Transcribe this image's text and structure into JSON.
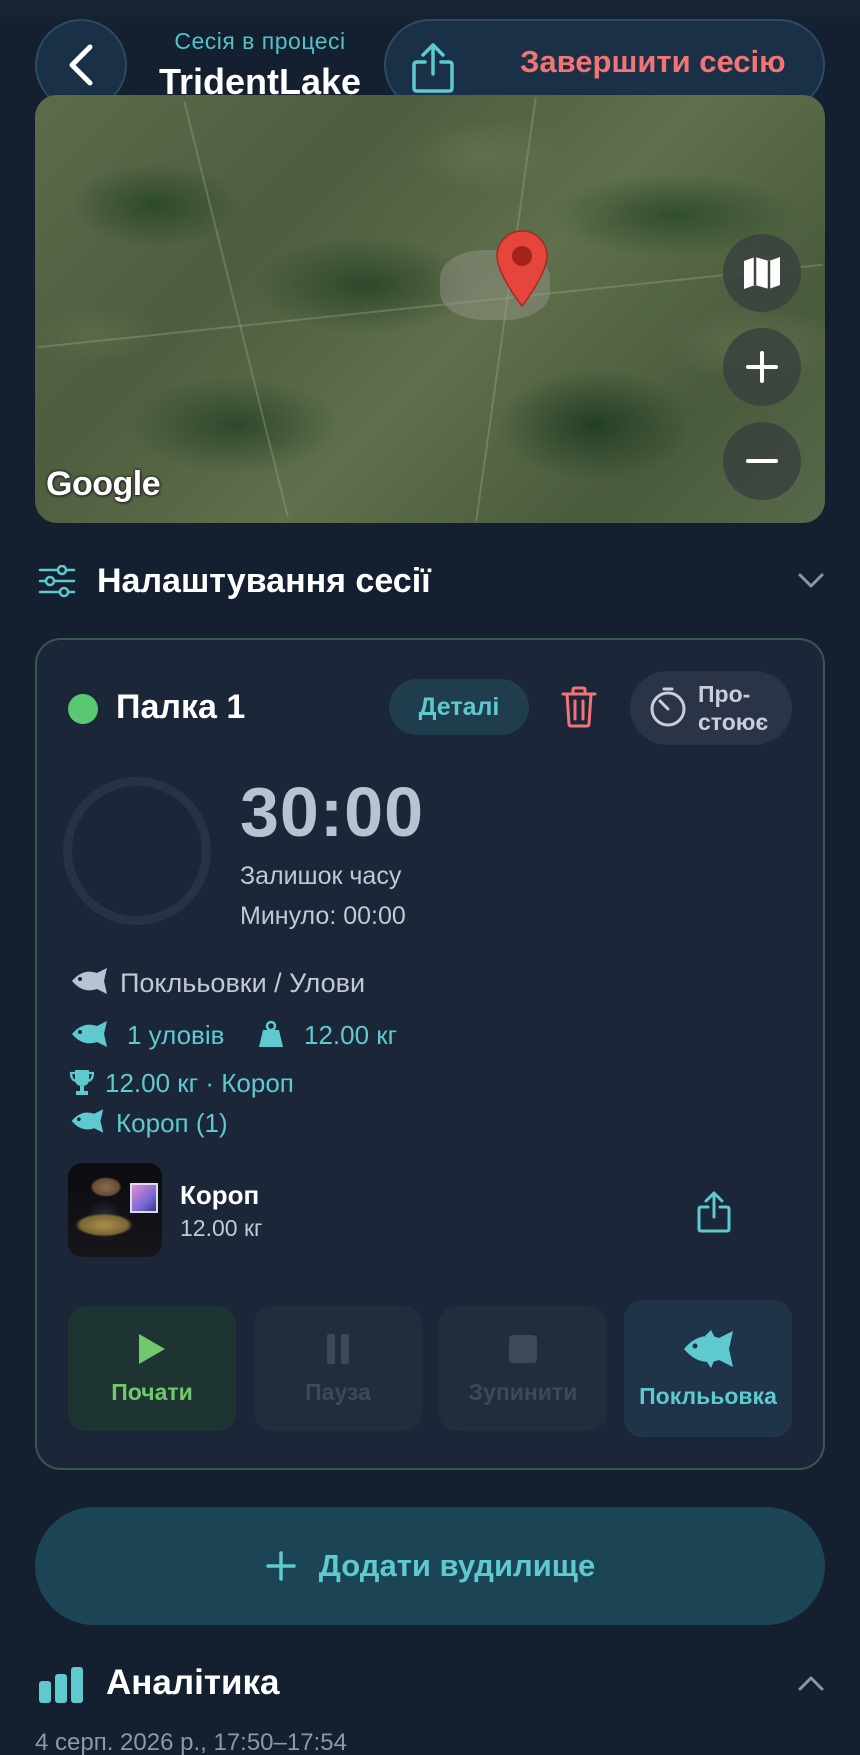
{
  "header": {
    "subtitle": "Сесія в процесі",
    "title": "TridentLake",
    "end_session_label": "Завершити сесію"
  },
  "map": {
    "provider_logo": "Google",
    "controls": [
      "map-layers-icon",
      "zoom-in-icon",
      "zoom-out-icon"
    ],
    "pin_color": "#e5453a"
  },
  "settings": {
    "label": "Налаштування сесії"
  },
  "rod": {
    "name": "Палка 1",
    "status_color": "#58c972",
    "details_label": "Деталі",
    "idle_status": "Про-\nстоює",
    "timer": "30:00",
    "timer_label": "Залишок часу",
    "elapsed": "Минуло: 00:00",
    "bites_label": "Поклььовки / Улови",
    "catch_count": "1 уловів",
    "weight_total": "12.00 кг",
    "best_catch": "12.00 кг · Короп",
    "species_count": "Короп (1)",
    "catch": {
      "name": "Короп",
      "weight": "12.00 кг"
    },
    "controls": {
      "start": "Почати",
      "pause": "Пауза",
      "stop": "Зупинити",
      "bite": "Поклььовка"
    }
  },
  "add_rod_label": "Додати вудилище",
  "analytics": {
    "label": "Аналітика",
    "date_range": "4 серп. 2026 р., 17:50–17:54"
  },
  "colors": {
    "background": "#14202f",
    "accent": "#5ec9cf",
    "danger": "#f27474",
    "start_green": "#72c96b"
  }
}
